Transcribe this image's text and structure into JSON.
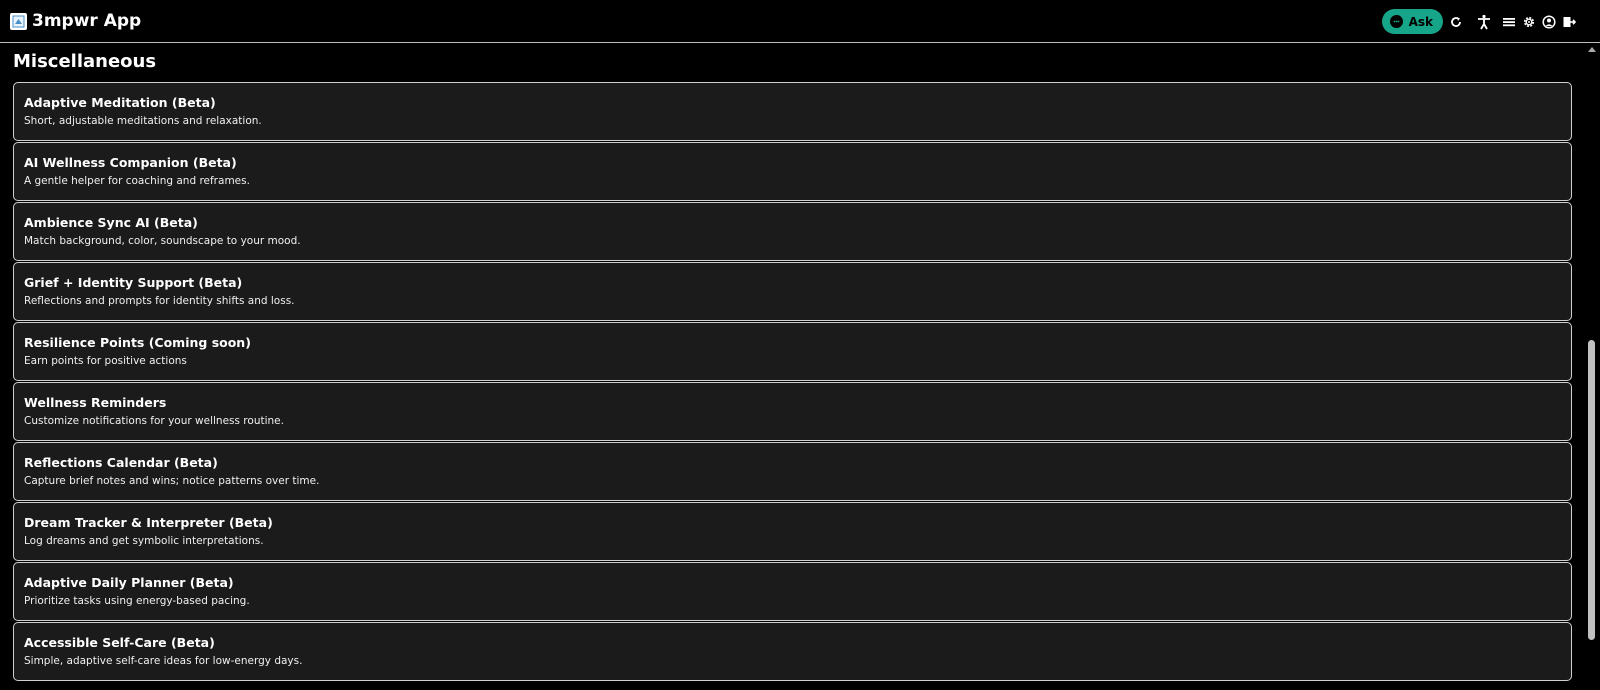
{
  "header": {
    "app_title": "3mpwr App",
    "ask_label": "Ask",
    "icons": [
      "chat-icon",
      "refresh-icon",
      "accessibility-icon",
      "menu-icon",
      "gear-icon",
      "user-icon",
      "logout-icon"
    ]
  },
  "colors": {
    "accent": "#17a589",
    "card_background": "#1b1b1b",
    "page_background": "#000000"
  },
  "main": {
    "section_title": "Miscellaneous",
    "items": [
      {
        "title": "Adaptive Meditation (Beta)",
        "description": "Short, adjustable meditations and relaxation."
      },
      {
        "title": "AI Wellness Companion (Beta)",
        "description": "A gentle helper for coaching and reframes."
      },
      {
        "title": "Ambience Sync AI (Beta)",
        "description": "Match background, color, soundscape to your mood."
      },
      {
        "title": "Grief + Identity Support (Beta)",
        "description": "Reflections and prompts for identity shifts and loss."
      },
      {
        "title": "Resilience Points (Coming soon)",
        "description": "Earn points for positive actions"
      },
      {
        "title": "Wellness Reminders",
        "description": "Customize notifications for your wellness routine."
      },
      {
        "title": "Reflections Calendar (Beta)",
        "description": "Capture brief notes and wins; notice patterns over time."
      },
      {
        "title": "Dream Tracker & Interpreter (Beta)",
        "description": "Log dreams and get symbolic interpretations."
      },
      {
        "title": "Adaptive Daily Planner (Beta)",
        "description": "Prioritize tasks using energy-based pacing."
      },
      {
        "title": "Accessible Self-Care (Beta)",
        "description": "Simple, adaptive self-care ideas for low-energy days."
      }
    ]
  }
}
